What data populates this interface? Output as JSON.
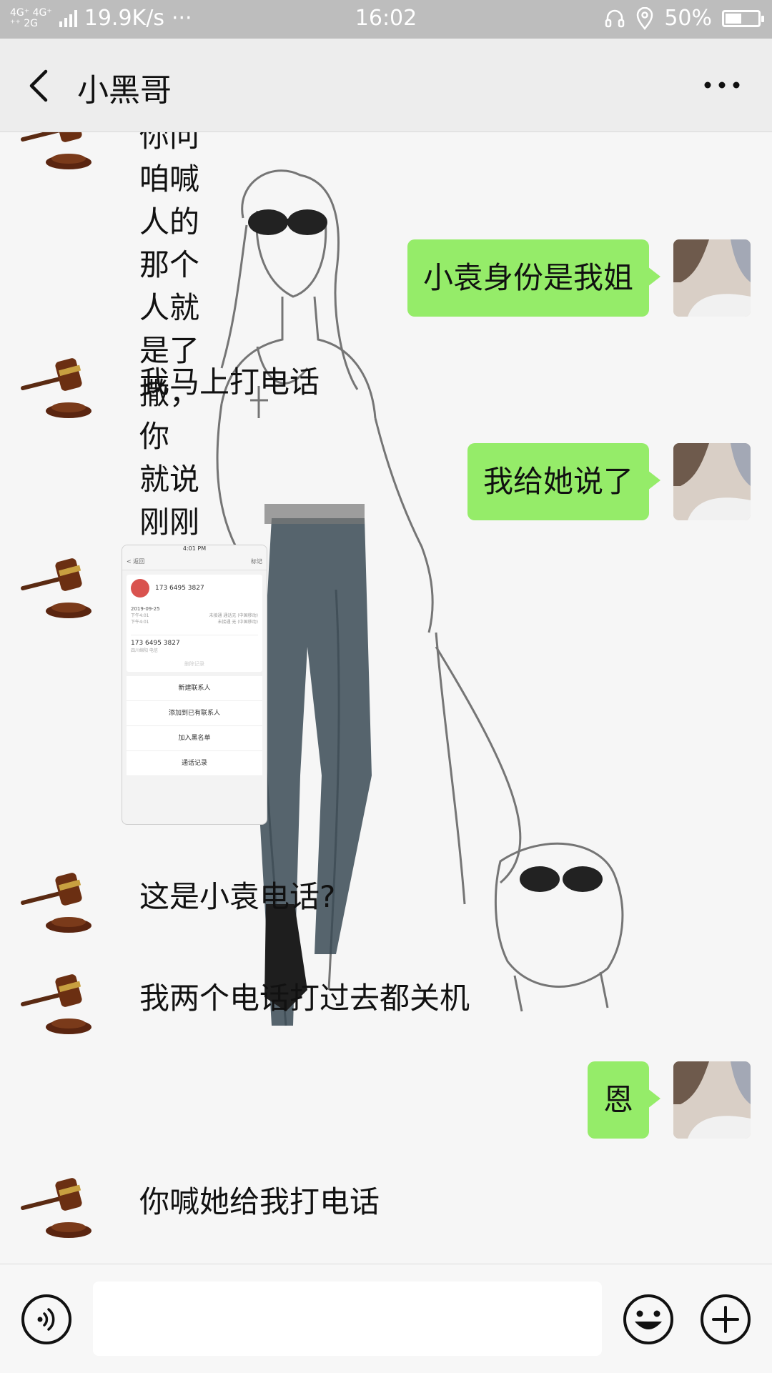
{
  "status_bar": {
    "network_top": "4G⁺ 4G⁺",
    "network_bottom": "⁺⁺ 2G",
    "speed": "19.9K/s",
    "dots": "···",
    "time": "16:02",
    "battery_percent": "50%",
    "battery_level": 0.5
  },
  "header": {
    "title": "小黑哥"
  },
  "messages": [
    {
      "side": "left",
      "text_line1": "你问咱喊人的那个人就是了撒，你",
      "text_line2": "就说刚刚上洗手间去了"
    },
    {
      "side": "right",
      "text": "小袁身份是我姐"
    },
    {
      "side": "left",
      "text": "我马上打电话"
    },
    {
      "side": "right",
      "text": "我给她说了"
    },
    {
      "side": "left",
      "type": "image",
      "screenshot": {
        "time": "4:01 PM",
        "back": "< 返回",
        "edit": "标记",
        "number": "173 6495 3827",
        "date": "2019-09-25",
        "call1_time": "下午4:01",
        "call1_note": "未接通 通话无 (中国移动)",
        "call2_time": "下午4:01",
        "call2_note": "未接通 无 (中国移动)",
        "number2": "173 6495 3827",
        "location": "四川绵阳 电信",
        "faded": "删除记录",
        "menu": [
          "新建联系人",
          "添加到已有联系人",
          "加入黑名单",
          "通话记录"
        ]
      }
    },
    {
      "side": "left",
      "text": "这是小袁电话?"
    },
    {
      "side": "left",
      "text": "我两个电话打过去都关机"
    },
    {
      "side": "right",
      "text": "恩"
    },
    {
      "side": "left",
      "text": "你喊她给我打电话"
    }
  ],
  "input": {
    "value": ""
  },
  "icons": {
    "back": "chevron-left-icon",
    "more": "more-dots-icon",
    "voice": "voice-icon",
    "emoji": "emoji-icon",
    "plus": "plus-icon"
  },
  "colors": {
    "bubble_green": "#95ec69",
    "header_bg": "#ededed",
    "status_bg": "#bdbdbd"
  }
}
